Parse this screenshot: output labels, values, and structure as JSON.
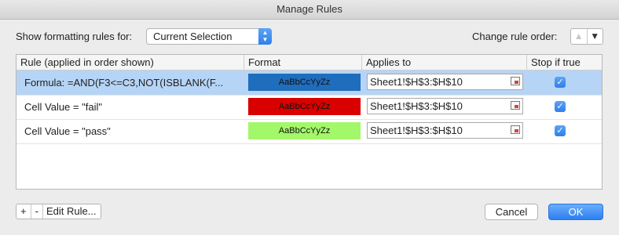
{
  "window": {
    "title": "Manage Rules"
  },
  "filter": {
    "label": "Show formatting rules for:",
    "selected": "Current Selection"
  },
  "order": {
    "label": "Change rule order:"
  },
  "columns": [
    "Rule (applied in order shown)",
    "Format",
    "Applies to",
    "Stop if true"
  ],
  "rules": [
    {
      "rule": "Formula: =AND(F3<=C3,NOT(ISBLANK(F...",
      "format_sample": "AaBbCcYyZz",
      "format_color": "#1f6dbd",
      "applies_to": "Sheet1!$H$3:$H$10",
      "stop_if_true": true,
      "selected": true
    },
    {
      "rule": "Cell Value = \"fail\"",
      "format_sample": "AaBbCcYyZz",
      "format_color": "#d90000",
      "applies_to": "Sheet1!$H$3:$H$10",
      "stop_if_true": true,
      "selected": false
    },
    {
      "rule": "Cell Value = \"pass\"",
      "format_sample": "AaBbCcYyZz",
      "format_color": "#a3f76a",
      "applies_to": "Sheet1!$H$3:$H$10",
      "stop_if_true": true,
      "selected": false
    }
  ],
  "footer": {
    "add": "+",
    "remove": "-",
    "edit": "Edit Rule...",
    "cancel": "Cancel",
    "ok": "OK"
  }
}
